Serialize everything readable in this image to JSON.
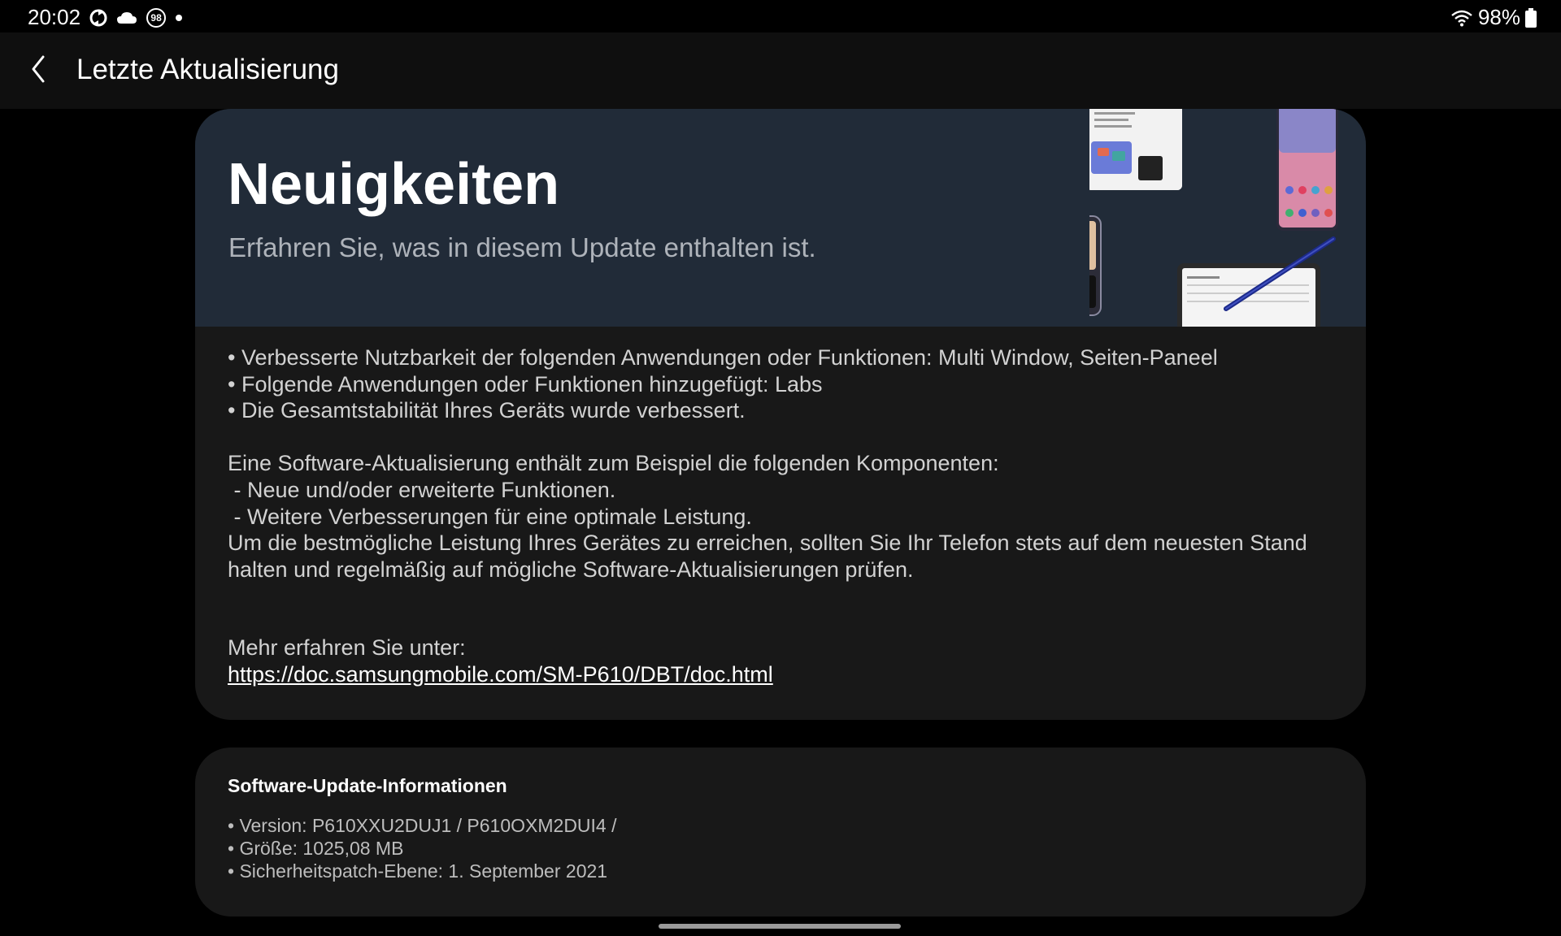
{
  "status_bar": {
    "time": "20:02",
    "left_icons": [
      "sync-icon",
      "cloud-icon",
      "notification-count-icon",
      "dot-icon"
    ],
    "notification_count": "98",
    "battery": "98%",
    "right_icons": [
      "wifi-icon",
      "battery-icon"
    ]
  },
  "app_bar": {
    "title": "Letzte Aktualisierung",
    "back_icon": "back-arrow-icon"
  },
  "news": {
    "title": "Neuigkeiten",
    "subtitle": "Erfahren Sie, was in diesem Update enthalten ist.",
    "bullets": [
      "• Verbesserte Nutzbarkeit der folgenden Anwendungen oder Funktionen: Multi Window, Seiten-Paneel",
      "• Folgende Anwendungen oder Funktionen hinzugefügt: Labs",
      "• Die Gesamtstabilität Ihres Geräts wurde verbessert."
    ],
    "components_intro": "Eine Software-Aktualisierung enthält zum Beispiel die folgenden Komponenten:",
    "components": [
      " - Neue und/oder erweiterte Funktionen.",
      " - Weitere Verbesserungen für eine optimale Leistung."
    ],
    "advice_line1": "Um die bestmögliche Leistung Ihres Gerätes zu erreichen, sollten Sie Ihr Telefon stets auf dem neuesten Stand",
    "advice_line2": "halten und regelmäßig auf mögliche Software-Aktualisierungen prüfen.",
    "more_label": "Mehr erfahren Sie unter:",
    "link": "https://doc.samsungmobile.com/SM-P610/DBT/doc.html"
  },
  "info": {
    "title": "Software-Update-Informationen",
    "items": [
      "• Version: P610XXU2DUJ1 / P610OXM2DUI4 /",
      "• Größe: 1025,08 MB",
      "• Sicherheitspatch-Ebene: 1. September 2021"
    ]
  },
  "colors": {
    "background": "#000000",
    "card": "#181818",
    "hero": "#212b38",
    "text_secondary": "#d2d2d2"
  }
}
